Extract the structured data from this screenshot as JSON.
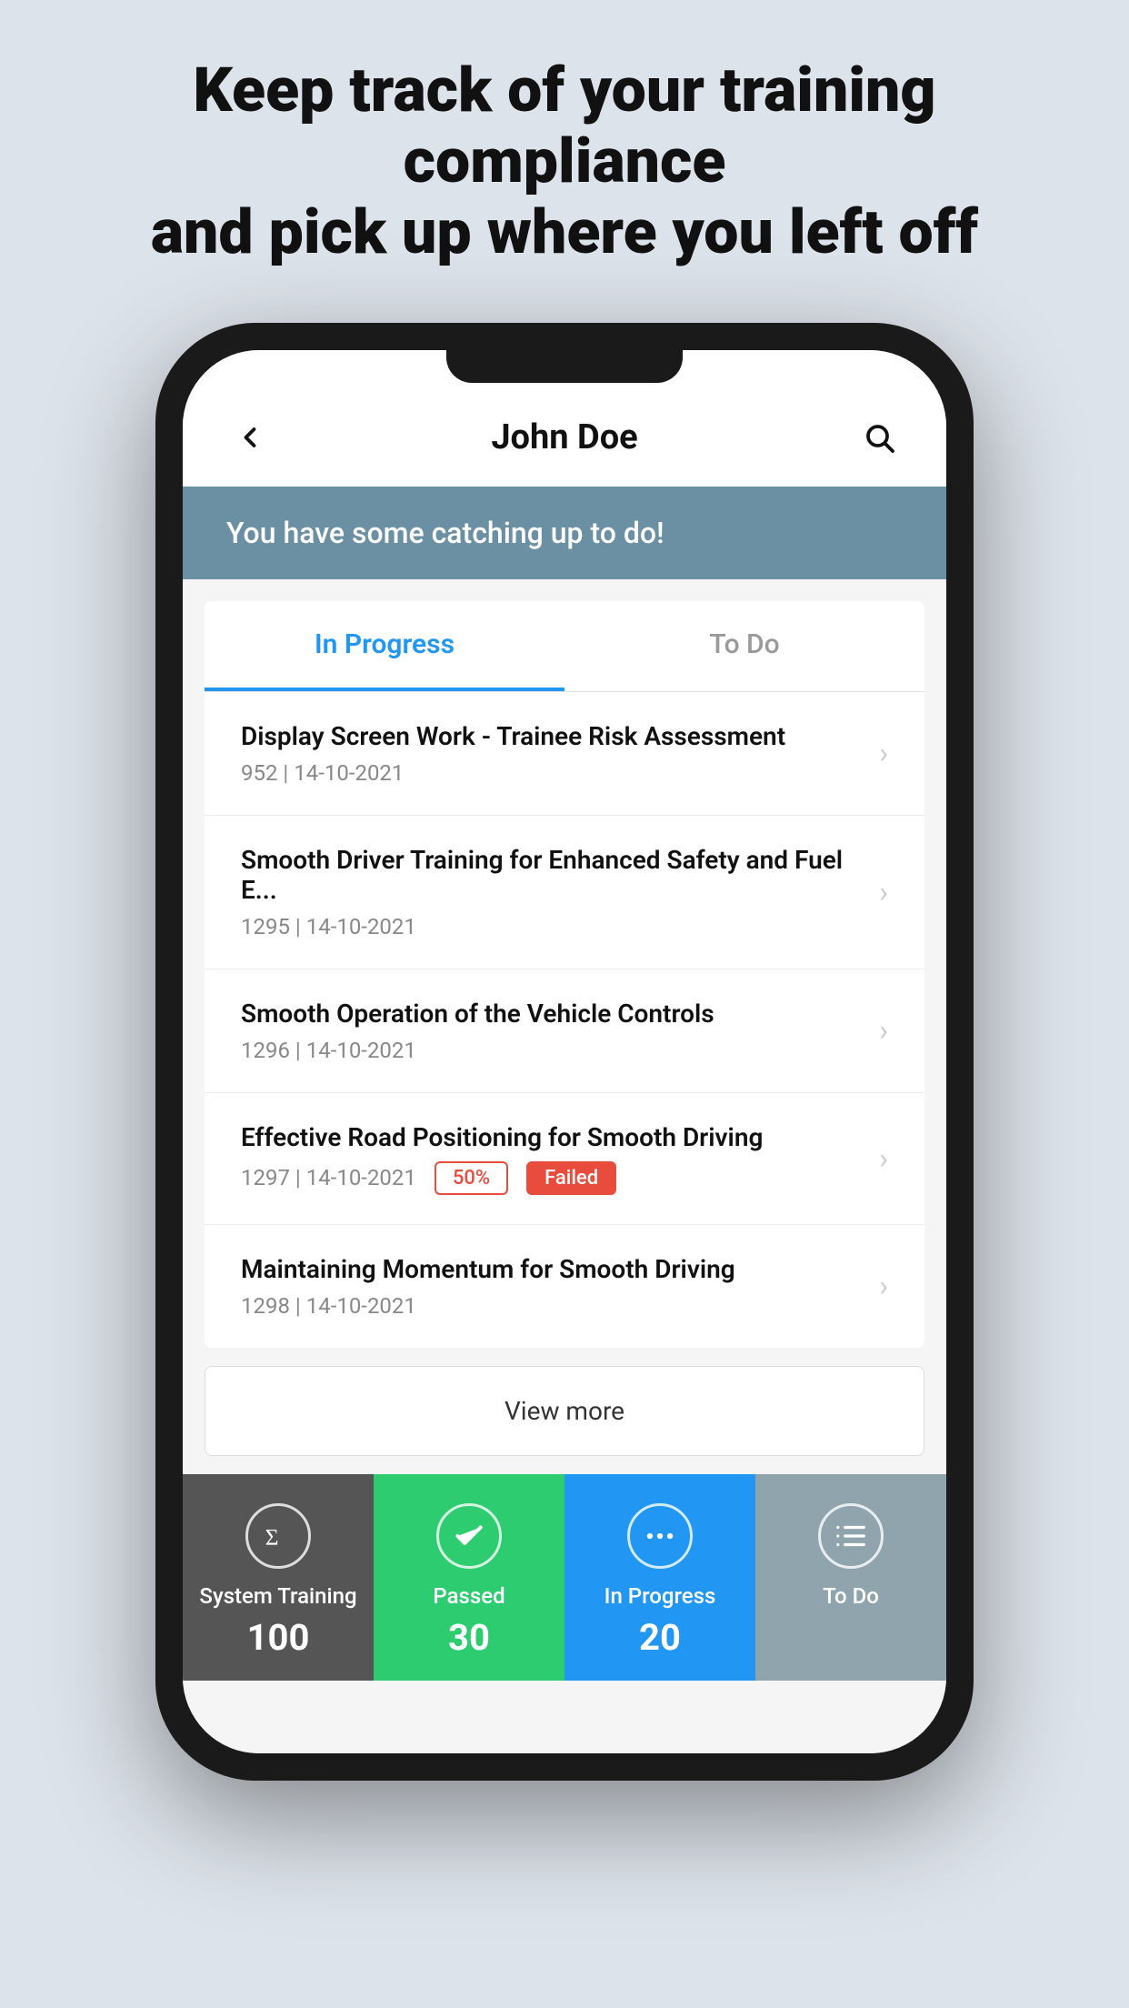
{
  "headline": {
    "line1": "Keep track of your training compliance",
    "line2": "and pick up where you left off"
  },
  "header": {
    "title": "John Doe",
    "back_label": "<",
    "search_label": "search"
  },
  "banner": {
    "text": "You have some catching up to do!"
  },
  "tabs": [
    {
      "label": "In Progress",
      "active": true
    },
    {
      "label": "To Do",
      "active": false
    }
  ],
  "list_items": [
    {
      "title": "Display Screen Work - Trainee Risk Assessment",
      "meta": "952 | 14-10-2021",
      "has_badge": false
    },
    {
      "title": "Smooth Driver Training for Enhanced Safety and Fuel E...",
      "meta": "1295 | 14-10-2021",
      "has_badge": false
    },
    {
      "title": "Smooth Operation of the Vehicle Controls",
      "meta": "1296 | 14-10-2021",
      "has_badge": false
    },
    {
      "title": "Effective Road Positioning for Smooth Driving",
      "meta": "1297 | 14-10-2021",
      "has_badge": true,
      "percent": "50%",
      "status": "Failed"
    },
    {
      "title": "Maintaining Momentum for Smooth Driving",
      "meta": "1298 | 14-10-2021",
      "has_badge": false
    }
  ],
  "view_more": "View more",
  "bottom_tabs": [
    {
      "key": "system",
      "label": "System Training",
      "count": "100",
      "icon": "sigma"
    },
    {
      "key": "passed",
      "label": "Passed",
      "count": "30",
      "icon": "check"
    },
    {
      "key": "inprogress",
      "label": "In Progress",
      "count": "20",
      "icon": "dots"
    },
    {
      "key": "todo",
      "label": "To Do",
      "count": "",
      "icon": "list"
    }
  ]
}
